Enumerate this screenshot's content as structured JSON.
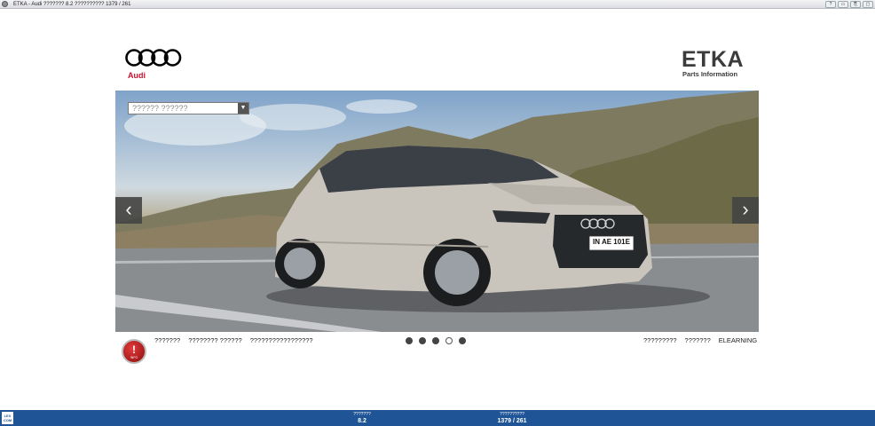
{
  "window": {
    "title": "ETKA - Audi ??????? 8.2 ?????????? 1379 / 261",
    "controls": [
      "?",
      "▭",
      "⎘",
      "▢"
    ]
  },
  "brand": {
    "audi_wordmark": "Audi",
    "etka_logo": "ETKA",
    "etka_subtitle": "Parts Information"
  },
  "selector": {
    "placeholder": "?????? ??????",
    "arrow_icon": "chevron-down-icon"
  },
  "carousel": {
    "prev_icon": "chevron-left-icon",
    "next_icon": "chevron-right-icon",
    "slide_count": 5,
    "active_index": 3,
    "plate_text": "IN AE 101E"
  },
  "info_badge": {
    "mark": "!",
    "label": "INFO"
  },
  "footer_links_left": [
    "???????",
    "???????? ??????",
    "?????????????????"
  ],
  "footer_links_right": [
    "?????????",
    "???????",
    "ELEARNING"
  ],
  "status": {
    "logo": "LEX COM",
    "version_label": "???????",
    "version_value": "8.2",
    "data_label": "??????????",
    "data_value": "1379 / 261"
  },
  "colors": {
    "audi_red": "#c8102e",
    "statusbar_blue": "#1f5596",
    "etka_gray": "#3b3b3b"
  }
}
